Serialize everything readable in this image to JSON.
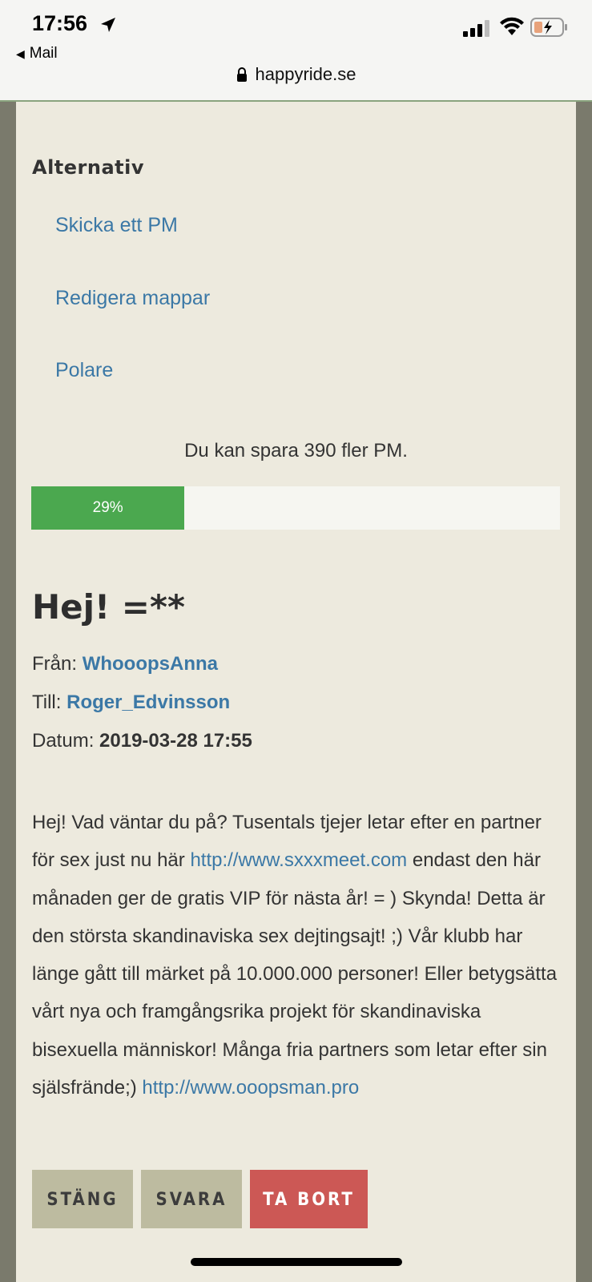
{
  "status_bar": {
    "time": "17:56",
    "back_label": "Mail"
  },
  "browser": {
    "url": "happyride.se"
  },
  "options": {
    "title": "Alternativ",
    "links": [
      "Skicka ett PM",
      "Redigera mappar",
      "Polare"
    ]
  },
  "quota": {
    "text": "Du kan spara 390 fler PM.",
    "progress_label": "29%",
    "progress_fraction": 0.29,
    "fill_color": "#4ba84f"
  },
  "message": {
    "title": "Hej! =**",
    "from_label": "Från:",
    "from_user": "WhooopsAnna",
    "to_label": "Till:",
    "to_user": "Roger_Edvinsson",
    "date_label": "Datum:",
    "date_value": "2019-03-28 17:55",
    "body_part1": "Hej! Vad väntar du på? Tusentals tjejer letar efter en partner för sex just nu här ",
    "link1": "http://www.sxxxmeet.com",
    "body_part2": " endast den här månaden ger de gratis VIP för nästa år! = ) Skynda! Detta är den största skandinaviska sex dejtingsajt! ;) Vår klubb har länge gått till märket på 10.000.000 personer! Eller betygsätta vårt nya och framgångsrika projekt för skandinaviska bisexuella människor! Många fria partners som letar efter sin själsfrände;) ",
    "link2": "http://www.ooopsman.pro"
  },
  "actions": {
    "close": "STÄNG",
    "reply": "SVARA",
    "delete": "TA BORT"
  },
  "colors": {
    "link": "#3b78a6",
    "panel_bg": "#edeade",
    "delete_button": "#cc5855",
    "neutral_button": "#bdbba0"
  }
}
